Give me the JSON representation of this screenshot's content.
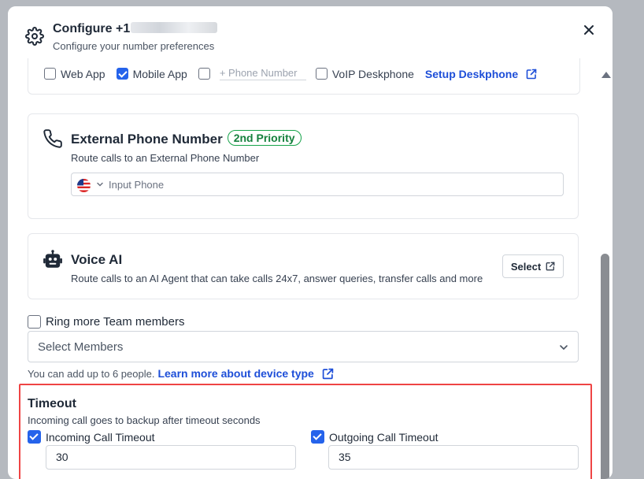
{
  "header": {
    "title": "Configure +1",
    "subtitle": "Configure your number preferences"
  },
  "devices": {
    "items": [
      {
        "label": "Web App",
        "checked": false
      },
      {
        "label": "Mobile App",
        "checked": true
      },
      {
        "label": "VoIP Deskphone",
        "checked": false
      }
    ],
    "phone_placeholder": "+ Phone Number",
    "setup_link": "Setup Deskphone"
  },
  "external_phone": {
    "title": "External Phone Number",
    "badge": "2nd Priority",
    "description": "Route calls to an External Phone Number",
    "input_placeholder": "Input Phone"
  },
  "voice_ai": {
    "title": "Voice AI",
    "description": "Route calls to an AI Agent that can take calls 24x7, answer queries, transfer calls and more",
    "select_label": "Select"
  },
  "team": {
    "checkbox_label": "Ring more Team members",
    "select_placeholder": "Select Members",
    "help_text": "You can add up to 6 people.",
    "help_link": "Learn more about device type"
  },
  "timeout": {
    "title": "Timeout",
    "description": "Incoming call goes to backup after timeout seconds",
    "incoming_label": "Incoming Call Timeout",
    "incoming_value": "30",
    "outgoing_label": "Outgoing Call Timeout",
    "outgoing_value": "35"
  },
  "colors": {
    "accent": "#2563eb",
    "badge_green": "#16a34a",
    "highlight_red": "#ef4444"
  }
}
